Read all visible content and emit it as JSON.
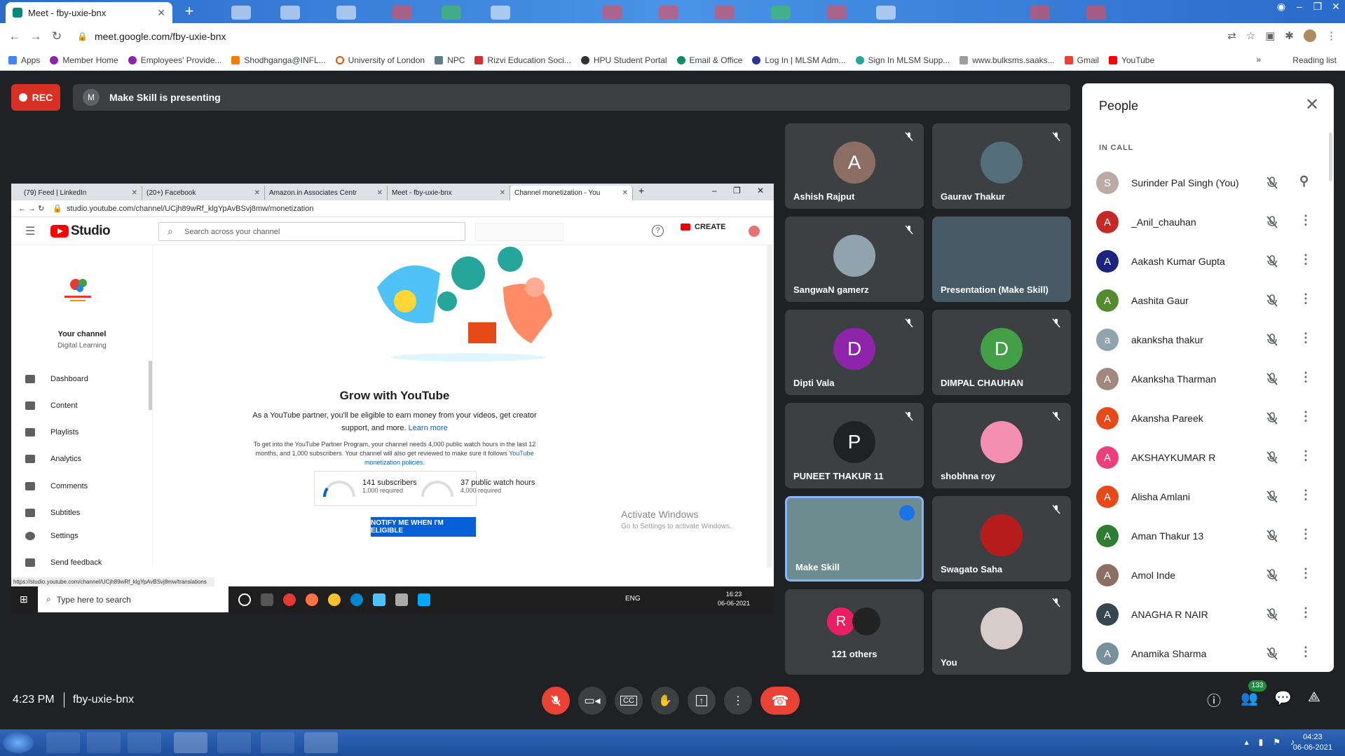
{
  "browser": {
    "tab_title": "Meet - fby-uxie-bnx",
    "url": "meet.google.com/fby-uxie-bnx",
    "bookmarks": [
      "Apps",
      "Member Home",
      "Employees' Provide...",
      "Shodhganga@INFL...",
      "University of London",
      "NPC",
      "Rizvi Education Soci...",
      "HPU Student Portal",
      "Email & Office",
      "Log In | MLSM Adm...",
      "Sign In MLSM Supp...",
      "www.bulksms.saaks...",
      "Gmail",
      "YouTube"
    ],
    "reading_list": "Reading list"
  },
  "meet": {
    "rec_label": "REC",
    "presenter_initial": "M",
    "presenter_text": "Make Skill is presenting",
    "time": "4:23 PM",
    "code": "fby-uxie-bnx",
    "people_count": "133"
  },
  "shared": {
    "tabs": [
      "(79) Feed | LinkedIn",
      "(20+) Facebook",
      "Amazon.in Associates Centr",
      "Meet - fby-uxie-bnx",
      "Channel monetization - You"
    ],
    "url": "studio.youtube.com/channel/UCjh89wRf_klgYpAvBSvj8mw/monetization",
    "studio": "Studio",
    "search_placeholder": "Search across your channel",
    "create": "CREATE",
    "your_channel": "Your channel",
    "channel_name": "Digital Learning",
    "sidebar": [
      "Dashboard",
      "Content",
      "Playlists",
      "Analytics",
      "Comments",
      "Subtitles",
      "Settings",
      "Send feedback"
    ],
    "headline": "Grow with YouTube",
    "desc_pre": "As a YouTube partner, you'll be eligible to earn money from your videos, get creator support, and more. ",
    "learn_more": "Learn more",
    "fine_pre": "To get into the YouTube Partner Program, your channel needs 4,000 public watch hours in the last 12 months, and 1,000 subscribers. Your channel will also get reviewed to make sure it follows ",
    "fine_link": "YouTube monetization policies.",
    "subs_value": "141 subscribers",
    "subs_req": "1,000 required",
    "hours_value": "37 public watch hours",
    "hours_req": "4,000 required",
    "notify": "NOTIFY ME WHEN I'M ELIGIBLE",
    "activate1": "Activate Windows",
    "activate2": "Go to Settings to activate Windows.",
    "status_url": "https://studio.youtube.com/channel/UCjh89wRf_klgYpAvBSvj8mw/translations",
    "taskbar_search": "Type here to search",
    "lang": "ENG",
    "clock_time": "16:23",
    "clock_date": "06-06-2021"
  },
  "tiles": [
    {
      "name": "Ashish Rajput",
      "initial": "A",
      "color": "#8d6e63"
    },
    {
      "name": "Gaurav Thakur",
      "initial": "",
      "color": "#546e7a"
    },
    {
      "name": "SangwaN gamerz",
      "initial": "",
      "color": "#90a4ae"
    },
    {
      "name": "Presentation (Make Skill)",
      "initial": "",
      "color": "#455a64"
    },
    {
      "name": "Dipti Vala",
      "initial": "D",
      "color": "#8e24aa"
    },
    {
      "name": "DIMPAL CHAUHAN",
      "initial": "D",
      "color": "#43a047"
    },
    {
      "name": "PUNEET THAKUR 11",
      "initial": "P",
      "color": "#202124"
    },
    {
      "name": "shobhna roy",
      "initial": "",
      "color": "#f48fb1"
    },
    {
      "name": "Make Skill",
      "initial": "",
      "color": "#6d8c8f"
    },
    {
      "name": "Swagato Saha",
      "initial": "",
      "color": "#b71c1c"
    },
    {
      "name": "121 others",
      "initial": "R",
      "color": "#e91e63"
    },
    {
      "name": "You",
      "initial": "",
      "color": "#d7ccc8"
    }
  ],
  "people": {
    "title": "People",
    "section": "IN CALL",
    "list": [
      {
        "name": "Surinder Pal Singh (You)",
        "initial": "S",
        "color": "#bcaaa4"
      },
      {
        "name": "_Anil_chauhan",
        "initial": "A",
        "color": "#c62828"
      },
      {
        "name": "Aakash Kumar Gupta",
        "initial": "A",
        "color": "#1a237e"
      },
      {
        "name": "Aashita Gaur",
        "initial": "A",
        "color": "#558b2f"
      },
      {
        "name": "akanksha thakur",
        "initial": "a",
        "color": "#90a4ae"
      },
      {
        "name": "Akanksha Tharman",
        "initial": "A",
        "color": "#a1887f"
      },
      {
        "name": "Akansha Pareek",
        "initial": "A",
        "color": "#e64a19"
      },
      {
        "name": "AKSHAYKUMAR R",
        "initial": "A",
        "color": "#ec407a"
      },
      {
        "name": "Alisha Amlani",
        "initial": "A",
        "color": "#e64a19"
      },
      {
        "name": "Aman Thakur 13",
        "initial": "A",
        "color": "#2e7d32"
      },
      {
        "name": "Amol Inde",
        "initial": "A",
        "color": "#8d6e63"
      },
      {
        "name": "ANAGHA R NAIR",
        "initial": "A",
        "color": "#37474f"
      },
      {
        "name": "Anamika Sharma",
        "initial": "A",
        "color": "#78909c"
      }
    ]
  },
  "win": {
    "time": "04:23",
    "date": "06-06-2021"
  }
}
